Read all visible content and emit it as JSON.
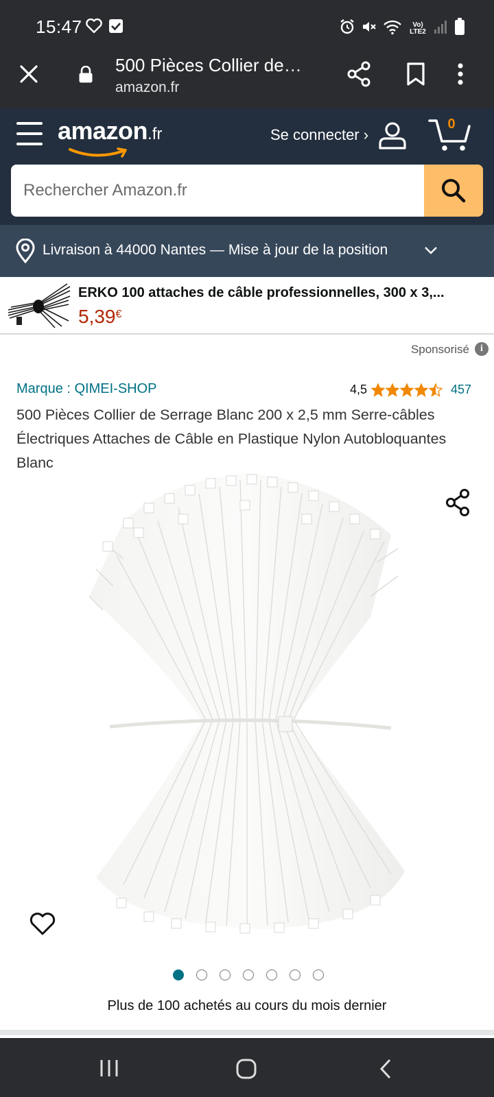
{
  "status_bar": {
    "time": "15:47",
    "network_label": "Vo) LTE2",
    "icons": [
      "heart-outline-icon",
      "checkbox-icon",
      "alarm-icon",
      "mute-icon",
      "wifi-icon",
      "signal-icon",
      "battery-icon"
    ]
  },
  "browser": {
    "title": "500 Pièces Collier de…",
    "domain": "amazon.fr",
    "icons": [
      "close-icon",
      "lock-icon",
      "share-icon",
      "bookmark-icon",
      "more-vertical-icon"
    ]
  },
  "header": {
    "logo_word": "amazon",
    "logo_suffix": ".fr",
    "signin": "Se connecter ›",
    "cart_count": "0",
    "search_placeholder": "Rechercher Amazon.fr"
  },
  "delivery": {
    "text": "Livraison à 44000 Nantes — Mise à jour de la position"
  },
  "sponsored_banner": {
    "title": "ERKO 100 attaches de câble professionnelles, 300 x 3,...",
    "price_main": "5,39",
    "price_currency": "€"
  },
  "sponsored_label": "Sponsorisé",
  "product": {
    "brand": "Marque : QIMEI-SHOP",
    "rating_value": "4,5",
    "rating_stars": 4.5,
    "rating_count": "457",
    "title": "500 Pièces Collier de Serrage Blanc 200 x 2,5 mm Serre-câbles Électriques Attaches de Câble en Plastique Nylon Autobloquantes Blanc",
    "image_count": 7,
    "image_active_index": 0,
    "bought_text": "Plus de 100 achetés au cours du mois dernier"
  },
  "colors": {
    "header_bg": "#232f3e",
    "delivery_bg": "#37475a",
    "search_btn": "#febd69",
    "link": "#007185",
    "price": "#b12704",
    "star": "#f08804",
    "system_bar": "#2a2c30"
  }
}
